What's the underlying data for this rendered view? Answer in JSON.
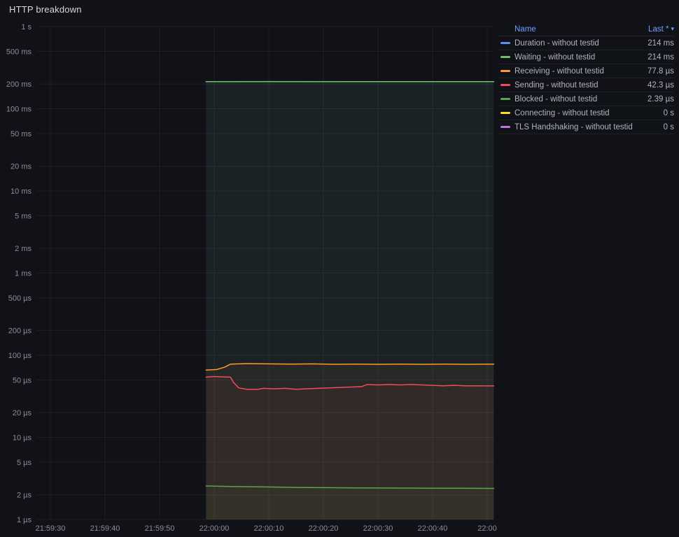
{
  "panel": {
    "title": "HTTP breakdown"
  },
  "legend": {
    "name_header": "Name",
    "sort_header": "Last *",
    "sort_caret": "▾"
  },
  "chart_data": {
    "type": "line",
    "title": "HTTP breakdown",
    "y_scale": "log",
    "y_unit": "duration",
    "x_axis": "time",
    "grid": true,
    "legend_position": "right-top",
    "y_ticks": [
      {
        "v": 1000000,
        "label": "1 s"
      },
      {
        "v": 500000,
        "label": "500 ms"
      },
      {
        "v": 200000,
        "label": "200 ms"
      },
      {
        "v": 100000,
        "label": "100 ms"
      },
      {
        "v": 50000,
        "label": "50 ms"
      },
      {
        "v": 20000,
        "label": "20 ms"
      },
      {
        "v": 10000,
        "label": "10 ms"
      },
      {
        "v": 5000,
        "label": "5 ms"
      },
      {
        "v": 2000,
        "label": "2 ms"
      },
      {
        "v": 1000,
        "label": "1 ms"
      },
      {
        "v": 500,
        "label": "500 µs"
      },
      {
        "v": 200,
        "label": "200 µs"
      },
      {
        "v": 100,
        "label": "100 µs"
      },
      {
        "v": 50,
        "label": "50 µs"
      },
      {
        "v": 20,
        "label": "20 µs"
      },
      {
        "v": 10,
        "label": "10 µs"
      },
      {
        "v": 5,
        "label": "5 µs"
      },
      {
        "v": 2,
        "label": "2 µs"
      },
      {
        "v": 1,
        "label": "1 µs"
      }
    ],
    "x_ticks": [
      {
        "t": 0,
        "label": "21:59:30"
      },
      {
        "t": 10,
        "label": "21:59:40"
      },
      {
        "t": 20,
        "label": "21:59:50"
      },
      {
        "t": 30,
        "label": "22:00:00"
      },
      {
        "t": 40,
        "label": "22:00:10"
      },
      {
        "t": 50,
        "label": "22:00:20"
      },
      {
        "t": 60,
        "label": "22:00:30"
      },
      {
        "t": 70,
        "label": "22:00:40"
      },
      {
        "t": 80,
        "label": "22:00"
      }
    ],
    "series": [
      {
        "name": "Duration - without testid",
        "color": "#5794F2",
        "last": "214 ms",
        "points": [
          [
            28.5,
            213500
          ],
          [
            40,
            214200
          ],
          [
            55,
            213900
          ],
          [
            70,
            214100
          ],
          [
            81.2,
            214000
          ]
        ]
      },
      {
        "name": "Waiting - without testid",
        "color": "#73BF69",
        "last": "214 ms",
        "points": [
          [
            28.5,
            213400
          ],
          [
            40,
            214100
          ],
          [
            55,
            213800
          ],
          [
            70,
            214000
          ],
          [
            81.2,
            213900
          ]
        ]
      },
      {
        "name": "Receiving - without testid",
        "color": "#FF9830",
        "last": "77.8 µs",
        "points": [
          [
            28.5,
            66
          ],
          [
            30.5,
            67
          ],
          [
            32,
            72
          ],
          [
            33,
            78
          ],
          [
            36,
            79
          ],
          [
            40,
            78.5
          ],
          [
            44,
            78
          ],
          [
            48,
            78.5
          ],
          [
            52,
            77.5
          ],
          [
            56,
            78
          ],
          [
            60,
            77.5
          ],
          [
            64,
            78
          ],
          [
            68,
            77.5
          ],
          [
            72,
            78
          ],
          [
            76,
            77.5
          ],
          [
            81.2,
            77.8
          ]
        ]
      },
      {
        "name": "Sending - without testid",
        "color": "#F2495C",
        "last": "42.3 µs",
        "points": [
          [
            28.5,
            54
          ],
          [
            30,
            55
          ],
          [
            31.5,
            54.5
          ],
          [
            33,
            54
          ],
          [
            33.5,
            47
          ],
          [
            34.5,
            40
          ],
          [
            36,
            38.5
          ],
          [
            38,
            38.5
          ],
          [
            39,
            39.5
          ],
          [
            41,
            39
          ],
          [
            43,
            39.5
          ],
          [
            45,
            38.5
          ],
          [
            47,
            39
          ],
          [
            49,
            39.5
          ],
          [
            51,
            40
          ],
          [
            53,
            40.5
          ],
          [
            55,
            41
          ],
          [
            57,
            41.5
          ],
          [
            58,
            44
          ],
          [
            60,
            43.5
          ],
          [
            62,
            44
          ],
          [
            64,
            43.5
          ],
          [
            66,
            44
          ],
          [
            68,
            43.5
          ],
          [
            70,
            43
          ],
          [
            72,
            42.5
          ],
          [
            74,
            43
          ],
          [
            76,
            42.5
          ],
          [
            78,
            42.5
          ],
          [
            81.2,
            42.3
          ]
        ]
      },
      {
        "name": "Blocked - without testid",
        "color": "#56A64B",
        "last": "2.39 µs",
        "points": [
          [
            28.5,
            2.56
          ],
          [
            33,
            2.52
          ],
          [
            38,
            2.5
          ],
          [
            45,
            2.46
          ],
          [
            52,
            2.44
          ],
          [
            60,
            2.42
          ],
          [
            68,
            2.41
          ],
          [
            75,
            2.4
          ],
          [
            81.2,
            2.39
          ]
        ]
      },
      {
        "name": "Connecting - without testid",
        "color": "#FADE2A",
        "last": "0 s",
        "points": []
      },
      {
        "name": "TLS Handshaking - without testid",
        "color": "#B877D9",
        "last": "0 s",
        "points": []
      }
    ]
  }
}
